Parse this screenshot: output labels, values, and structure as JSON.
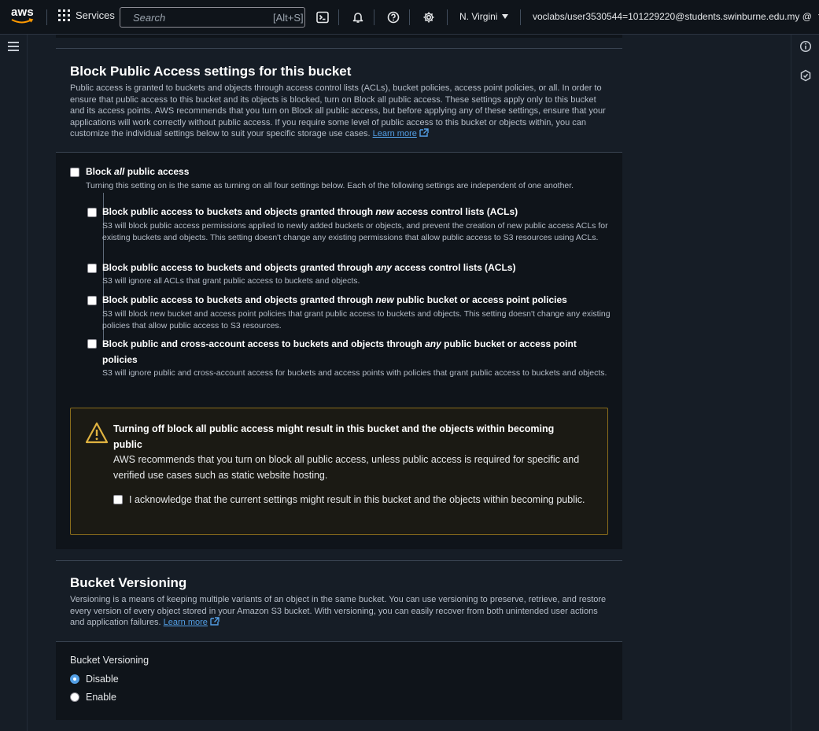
{
  "nav": {
    "logo": "aws",
    "services_label": "Services",
    "search_placeholder": "Search",
    "search_shortcut": "[Alt+S]",
    "region": "N. Virgini",
    "account": "voclabs/user3530544=101229220@students.swinburne.edu.my @",
    "icons": [
      "cloudshell-icon",
      "bell-icon",
      "help-icon",
      "gear-icon"
    ]
  },
  "block_public_access": {
    "title": "Block Public Access settings for this bucket",
    "description": "Public access is granted to buckets and objects through access control lists (ACLs), bucket policies, access point policies, or all. In order to ensure that public access to this bucket and its objects is blocked, turn on Block all public access. These settings apply only to this bucket and its access points. AWS recommends that you turn on Block all public access, but before applying any of these settings, ensure that your applications will work correctly without public access. If you require some level of public access to this bucket or objects within, you can customize the individual settings below to suit your specific storage use cases.",
    "learn_more": "Learn more",
    "block_all": {
      "prefix": "Block ",
      "emphasis": "all",
      "suffix": " public access",
      "checked": false,
      "description": "Turning this setting on is the same as turning on all four settings below. Each of the following settings are independent of one another."
    },
    "options": [
      {
        "prefix": "Block public access to buckets and objects granted through ",
        "emphasis": "new",
        "suffix": " access control lists (ACLs)",
        "checked": false,
        "description": "S3 will block public access permissions applied to newly added buckets or objects, and prevent the creation of new public access ACLs for existing buckets and objects. This setting doesn't change any existing permissions that allow public access to S3 resources using ACLs."
      },
      {
        "prefix": "Block public access to buckets and objects granted through ",
        "emphasis": "any",
        "suffix": " access control lists (ACLs)",
        "checked": false,
        "description": "S3 will ignore all ACLs that grant public access to buckets and objects."
      },
      {
        "prefix": "Block public access to buckets and objects granted through ",
        "emphasis": "new",
        "suffix": " public bucket or access point policies",
        "checked": false,
        "description": "S3 will block new bucket and access point policies that grant public access to buckets and objects. This setting doesn't change any existing policies that allow public access to S3 resources."
      },
      {
        "prefix": "Block public and cross-account access to buckets and objects through ",
        "emphasis": "any",
        "suffix": " public bucket or access point policies",
        "checked": false,
        "description": "S3 will ignore public and cross-account access for buckets and access points with policies that grant public access to buckets and objects."
      }
    ],
    "warning": {
      "title": "Turning off block all public access might result in this bucket and the objects within becoming public",
      "body": "AWS recommends that you turn on block all public access, unless public access is required for specific and verified use cases such as static website hosting.",
      "acknowledge": "I acknowledge that the current settings might result in this bucket and the objects within becoming public.",
      "acknowledge_checked": false
    }
  },
  "versioning": {
    "title": "Bucket Versioning",
    "description": "Versioning is a means of keeping multiple variants of an object in the same bucket. You can use versioning to preserve, retrieve, and restore every version of every object stored in your Amazon S3 bucket. With versioning, you can easily recover from both unintended user actions and application failures.",
    "learn_more": "Learn more",
    "field_label": "Bucket Versioning",
    "options": [
      "Disable",
      "Enable"
    ],
    "selected": "Disable"
  },
  "colors": {
    "accent": "#539fe5",
    "warning_border": "#8a6d1c",
    "warning_icon": "#e0b340"
  }
}
